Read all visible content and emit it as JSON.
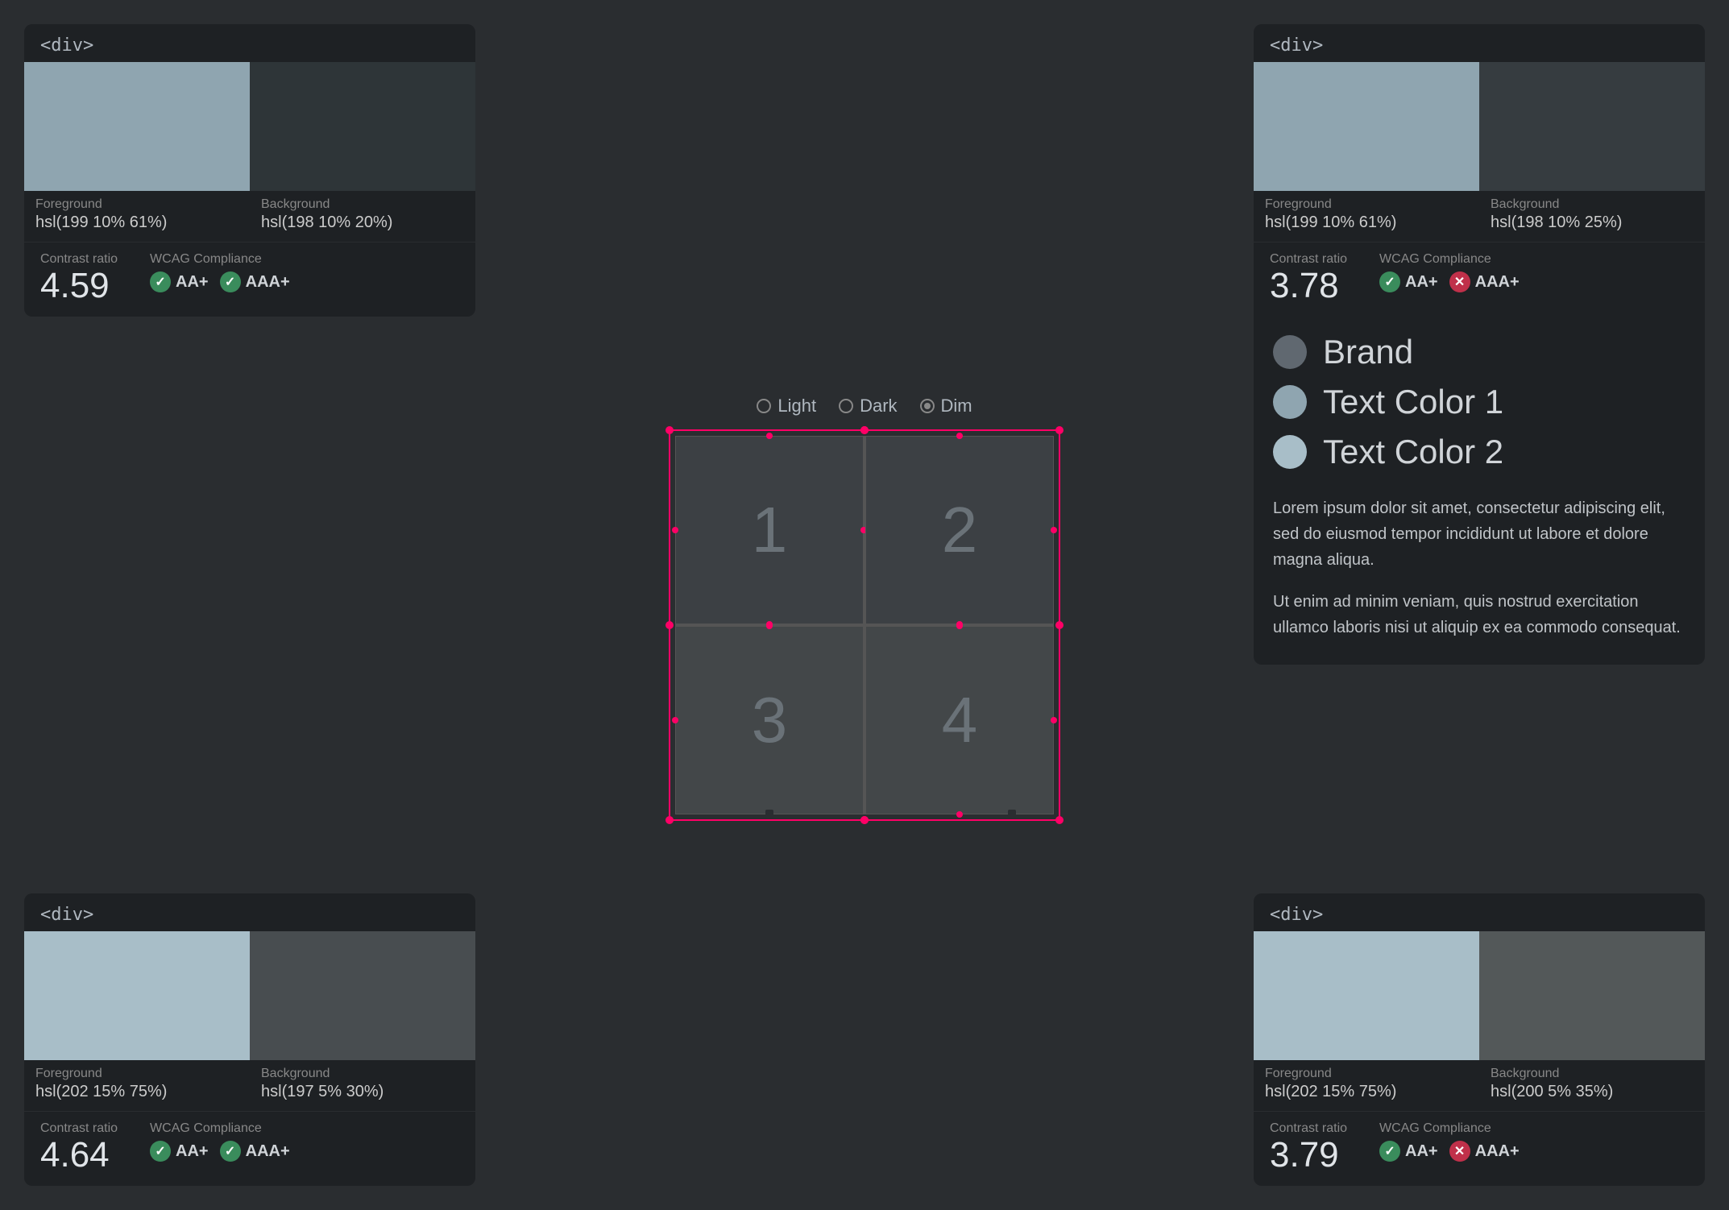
{
  "cards": {
    "top_left": {
      "tag": "<div>",
      "foreground_label": "Foreground",
      "foreground_value": "hsl(199 10% 61%)",
      "foreground_color": "#8fa5b0",
      "background_label": "Background",
      "background_value": "hsl(198 10% 20%)",
      "background_color": "#2e3538",
      "contrast_label": "Contrast ratio",
      "contrast_value": "4.59",
      "wcag_label": "WCAG Compliance",
      "badge_aa": "AA+",
      "badge_aaa": "AAA+",
      "aa_pass": true,
      "aaa_pass": true
    },
    "top_right": {
      "tag": "<div>",
      "foreground_label": "Foreground",
      "foreground_value": "hsl(199 10% 61%)",
      "foreground_color": "#8fa5b0",
      "background_label": "Background",
      "background_value": "hsl(198 10% 25%)",
      "background_color": "#363c40",
      "contrast_label": "Contrast ratio",
      "contrast_value": "3.78",
      "wcag_label": "WCAG Compliance",
      "badge_aa": "AA+",
      "badge_aaa": "AAA+",
      "aa_pass": true,
      "aaa_pass": false
    },
    "bottom_left": {
      "tag": "<div>",
      "foreground_label": "Foreground",
      "foreground_value": "hsl(202 15% 75%)",
      "foreground_color": "#a8bec8",
      "background_label": "Background",
      "background_value": "hsl(197 5% 30%)",
      "background_color": "#484d50",
      "contrast_label": "Contrast ratio",
      "contrast_value": "4.64",
      "wcag_label": "WCAG Compliance",
      "badge_aa": "AA+",
      "badge_aaa": "AAA+",
      "aa_pass": true,
      "aaa_pass": true
    },
    "bottom_right": {
      "tag": "<div>",
      "foreground_label": "Foreground",
      "foreground_value": "hsl(202 15% 75%)",
      "foreground_color": "#a8bec8",
      "background_label": "Background",
      "background_value": "hsl(200 5% 35%)",
      "background_color": "#535859",
      "contrast_label": "Contrast ratio",
      "contrast_value": "3.79",
      "wcag_label": "WCAG Compliance",
      "badge_aa": "AA+",
      "badge_aaa": "AAA+",
      "aa_pass": true,
      "aaa_pass": false
    }
  },
  "theme_selector": {
    "options": [
      "Light",
      "Dark",
      "Dim"
    ],
    "selected": "Dim"
  },
  "grid": {
    "cells": [
      "1",
      "2",
      "3",
      "4"
    ]
  },
  "legend": {
    "items": [
      {
        "label": "Brand",
        "color": "#606870"
      },
      {
        "label": "Text Color 1",
        "color": "#8fa5b0"
      },
      {
        "label": "Text Color 2",
        "color": "#a8bec8"
      }
    ]
  },
  "lorem": [
    "Lorem ipsum dolor sit amet, consectetur adipiscing elit, sed do eiusmod tempor incididunt ut labore et dolore magna aliqua.",
    "Ut enim ad minim veniam, quis nostrud exercitation ullamco laboris nisi ut aliquip ex ea commodo consequat."
  ]
}
